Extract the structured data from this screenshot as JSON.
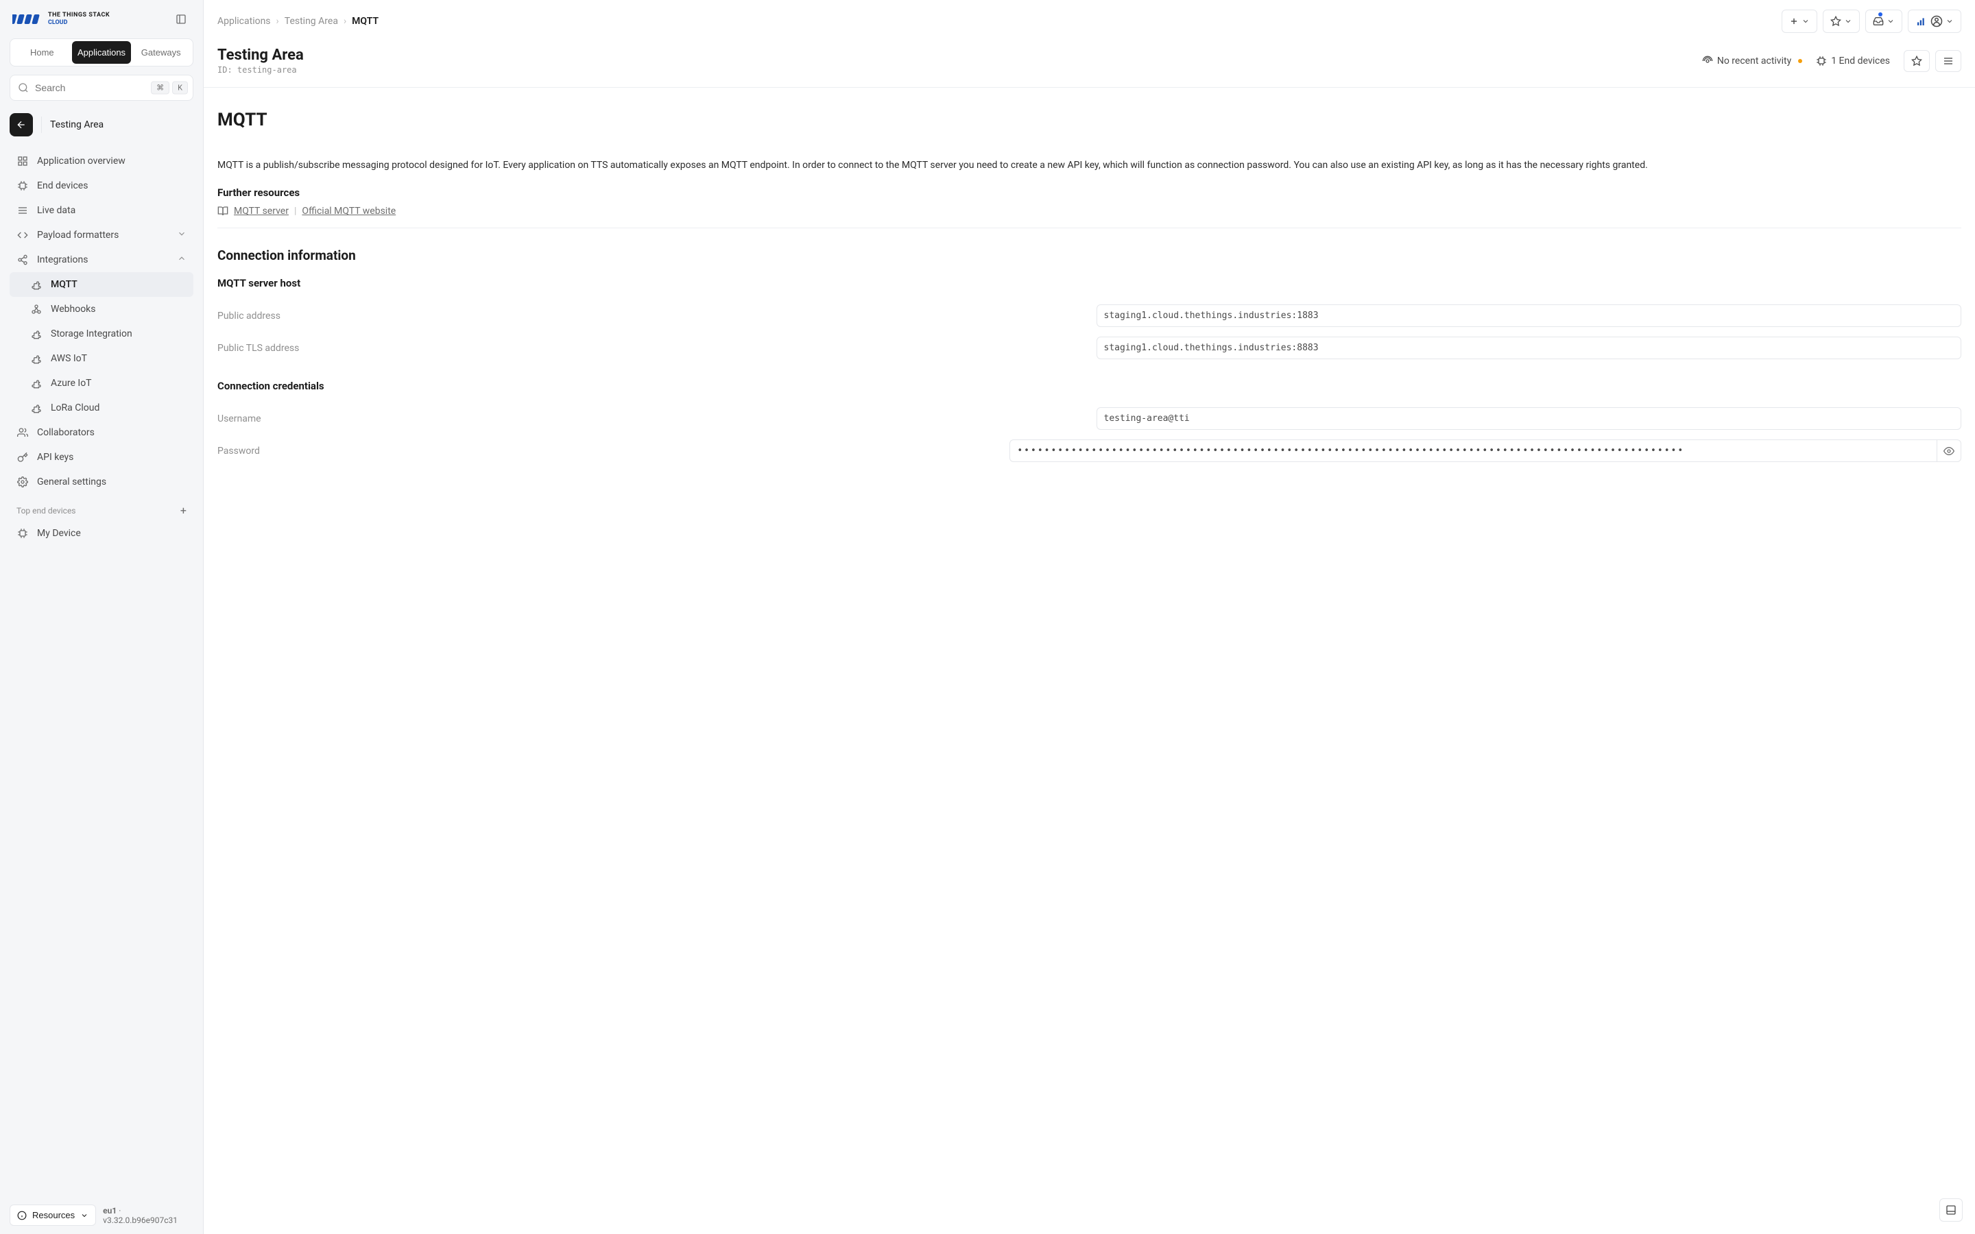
{
  "brand": {
    "main": "THE THINGS STACK",
    "sub": "CLOUD"
  },
  "tabs": {
    "home": "Home",
    "applications": "Applications",
    "gateways": "Gateways"
  },
  "search": {
    "placeholder": "Search",
    "kbd1": "⌘",
    "kbd2": "K"
  },
  "context": {
    "name": "Testing Area"
  },
  "nav": {
    "overview": "Application overview",
    "end_devices": "End devices",
    "live_data": "Live data",
    "payload": "Payload formatters",
    "integrations": "Integrations",
    "mqtt": "MQTT",
    "webhooks": "Webhooks",
    "storage": "Storage Integration",
    "aws": "AWS IoT",
    "azure": "Azure IoT",
    "lora": "LoRa Cloud",
    "collaborators": "Collaborators",
    "api_keys": "API keys",
    "general": "General settings"
  },
  "top_devices": {
    "label": "Top end devices",
    "item1": "My Device"
  },
  "footer": {
    "resources": "Resources",
    "region": "eu1",
    "version": "v3.32.0.b96e907c31"
  },
  "breadcrumbs": {
    "a": "Applications",
    "b": "Testing Area",
    "c": "MQTT"
  },
  "page": {
    "title": "Testing Area",
    "id_label": "ID:",
    "id_value": "testing-area"
  },
  "meta": {
    "activity": "No recent activity",
    "devices": "1 End devices"
  },
  "mqtt": {
    "title": "MQTT",
    "description": "MQTT is a publish/subscribe messaging protocol designed for IoT. Every application on TTS automatically exposes an MQTT endpoint. In order to connect to the MQTT server you need to create a new API key, which will function as connection password. You can also use an existing API key, as long as it has the necessary rights granted.",
    "further": "Further resources",
    "link1": "MQTT server",
    "link2": "Official MQTT website",
    "conn_title": "Connection information",
    "host_title": "MQTT server host",
    "public_addr_label": "Public address",
    "public_addr_value": "staging1.cloud.thethings.industries:1883",
    "tls_addr_label": "Public TLS address",
    "tls_addr_value": "staging1.cloud.thethings.industries:8883",
    "creds_title": "Connection credentials",
    "username_label": "Username",
    "username_value": "testing-area@tti",
    "password_label": "Password",
    "password_value": "•••••••••••••••••••••••••••••••••••••••••••••••••••••••••••••••••••••••••••••••••••••••••••••••••••"
  }
}
